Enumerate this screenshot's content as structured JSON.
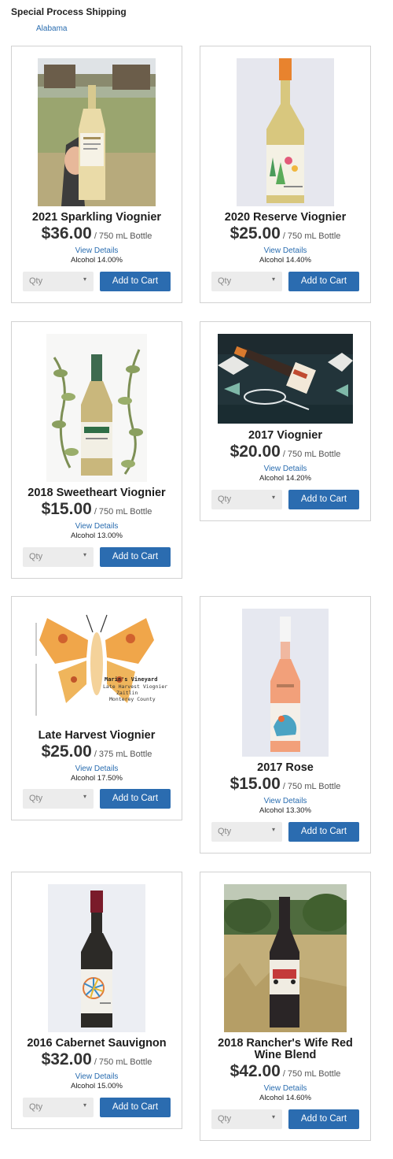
{
  "header": {
    "title": "Special Process Shipping",
    "region": "Alabama"
  },
  "labels": {
    "view_details": "View Details",
    "qty_placeholder": "Qty",
    "add_to_cart": "Add to Cart"
  },
  "products": [
    {
      "name": "2021 Sparkling Viognier",
      "price": "$36.00",
      "unit": "/ 750 mL Bottle",
      "alcohol": "Alcohol 14.00%"
    },
    {
      "name": "2020 Reserve Viognier",
      "price": "$25.00",
      "unit": "/ 750 mL Bottle",
      "alcohol": "Alcohol 14.40%"
    },
    {
      "name": "2018 Sweetheart Viognier",
      "price": "$15.00",
      "unit": "/ 750 mL Bottle",
      "alcohol": "Alcohol 13.00%"
    },
    {
      "name": "2017 Viognier",
      "price": "$20.00",
      "unit": "/ 750 mL Bottle",
      "alcohol": "Alcohol 14.20%"
    },
    {
      "name": "Late Harvest Viognier",
      "price": "$25.00",
      "unit": "/ 375 mL Bottle",
      "alcohol": "Alcohol 17.50%",
      "label_lines": [
        "Marin's Vineyard",
        "Late Harvest Viognier",
        "Zaitlin",
        "Monterey County"
      ]
    },
    {
      "name": "2017 Rose",
      "price": "$15.00",
      "unit": "/ 750 mL Bottle",
      "alcohol": "Alcohol 13.30%"
    },
    {
      "name": "2016 Cabernet Sauvignon",
      "price": "$32.00",
      "unit": "/ 750 mL Bottle",
      "alcohol": "Alcohol 15.00%"
    },
    {
      "name": "2018 Rancher's Wife Red Wine Blend",
      "price": "$42.00",
      "unit": "/ 750 mL Bottle",
      "alcohol": "Alcohol 14.60%"
    }
  ],
  "colors": {
    "accent": "#2b6cb0",
    "link": "#2a6db0",
    "card_border": "#d2d2d2",
    "qty_bg": "#ececec"
  }
}
